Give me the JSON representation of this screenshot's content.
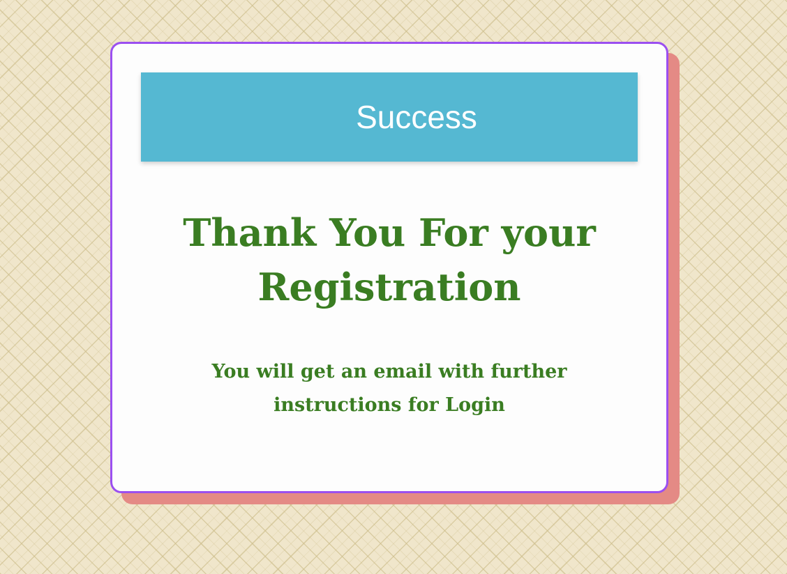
{
  "banner": {
    "label": "Success",
    "background_color": "#55b8d2"
  },
  "message": {
    "heading": "Thank You For your Registration",
    "subtext": "You will get an email with further instructions for Login",
    "text_color": "#3a7d22"
  },
  "card": {
    "border_color": "#9b4ff0",
    "shadow_color": "#e48a85"
  }
}
